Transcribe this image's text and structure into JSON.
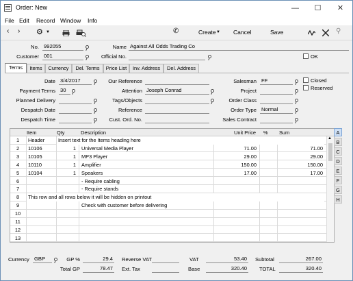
{
  "window": {
    "title": "Order: New"
  },
  "menu": [
    "File",
    "Edit",
    "Record",
    "Window",
    "Info"
  ],
  "toolbar": {
    "create": "Create",
    "cancel": "Cancel",
    "save": "Save"
  },
  "header": {
    "no_label": "No.",
    "no_value": "992055",
    "name_label": "Name",
    "name_value": "Against All Odds Trading Co",
    "customer_label": "Customer",
    "customer_value": "001",
    "official_label": "Official No.",
    "official_value": "",
    "ok_label": "OK"
  },
  "tabs": [
    "Terms",
    "Items",
    "Currency",
    "Del. Terms",
    "Price List",
    "Inv. Address",
    "Del. Address"
  ],
  "terms": {
    "date_label": "Date",
    "date_value": "3/4/2017",
    "payterms_label": "Payment Terms",
    "payterms_value": "30",
    "planned_label": "Planned Delivery",
    "planned_value": "",
    "despdate_label": "Despatch Date",
    "despdate_value": "",
    "desptime_label": "Despatch Time",
    "desptime_value": "",
    "ourref_label": "Our Reference",
    "ourref_value": "",
    "attention_label": "Attention",
    "attention_value": "Joseph Conrad",
    "tags_label": "Tags/Objects",
    "tags_value": "",
    "reference_label": "Reference",
    "reference_value": "",
    "custord_label": "Cust. Ord. No.",
    "custord_value": "",
    "salesman_label": "Salesman",
    "salesman_value": "FF",
    "project_label": "Project",
    "project_value": "",
    "orderclass_label": "Order Class",
    "orderclass_value": "",
    "ordertype_label": "Order Type",
    "ordertype_value": "Normal",
    "salescontract_label": "Sales Contract",
    "salescontract_value": "",
    "closed_label": "Closed",
    "reserved_label": "Reserved"
  },
  "grid": {
    "headers": {
      "item": "Item",
      "qty": "Qty",
      "desc": "Description",
      "price": "Unit Price",
      "pct": "%",
      "sum": "Sum"
    },
    "rows": [
      {
        "n": "1",
        "item": "Header",
        "qty": "",
        "desc": "",
        "price": "",
        "pct": "",
        "sum": "",
        "note": "Insert text for the Items heading here"
      },
      {
        "n": "2",
        "item": "10106",
        "qty": "1",
        "desc": "Universal Media Player",
        "price": "71.00",
        "pct": "",
        "sum": "71.00",
        "note": ""
      },
      {
        "n": "3",
        "item": "10105",
        "qty": "1",
        "desc": "MP3 Player",
        "price": "29.00",
        "pct": "",
        "sum": "29.00",
        "note": ""
      },
      {
        "n": "4",
        "item": "10110",
        "qty": "1",
        "desc": "Amplifier",
        "price": "150.00",
        "pct": "",
        "sum": "150.00",
        "note": ""
      },
      {
        "n": "5",
        "item": "10104",
        "qty": "1",
        "desc": "Speakers",
        "price": "17.00",
        "pct": "",
        "sum": "17.00",
        "note": ""
      },
      {
        "n": "6",
        "item": "",
        "qty": "",
        "desc": "- Require cabling",
        "price": "",
        "pct": "",
        "sum": "",
        "note": ""
      },
      {
        "n": "7",
        "item": "",
        "qty": "",
        "desc": "- Require stands",
        "price": "",
        "pct": "",
        "sum": "",
        "note": ""
      },
      {
        "n": "8",
        "item": "",
        "qty": "",
        "desc": "",
        "price": "",
        "pct": "",
        "sum": "",
        "note": "This row and all rows below it will be hidden on printout"
      },
      {
        "n": "9",
        "item": "",
        "qty": "",
        "desc": "Check with customer before delivering",
        "price": "",
        "pct": "",
        "sum": "",
        "note": ""
      },
      {
        "n": "10",
        "item": "",
        "qty": "",
        "desc": "",
        "price": "",
        "pct": "",
        "sum": "",
        "note": ""
      },
      {
        "n": "11",
        "item": "",
        "qty": "",
        "desc": "",
        "price": "",
        "pct": "",
        "sum": "",
        "note": ""
      },
      {
        "n": "12",
        "item": "",
        "qty": "",
        "desc": "",
        "price": "",
        "pct": "",
        "sum": "",
        "note": ""
      },
      {
        "n": "13",
        "item": "",
        "qty": "",
        "desc": "",
        "price": "",
        "pct": "",
        "sum": "",
        "note": ""
      }
    ],
    "letters": [
      "A",
      "B",
      "C",
      "D",
      "E",
      "F",
      "G",
      "H"
    ]
  },
  "footer": {
    "currency_label": "Currency",
    "currency_value": "GBP",
    "gp_label": "GP %",
    "gp_value": "29.4",
    "totalgp_label": "Total GP",
    "totalgp_value": "78.47",
    "revvat_label": "Reverse VAT",
    "revvat_value": "",
    "exttax_label": "Ext. Tax",
    "exttax_value": "",
    "vat_label": "VAT",
    "vat_value": "53.40",
    "base_label": "Base",
    "base_value": "320.40",
    "subtotal_label": "Subtotal",
    "subtotal_value": "267.00",
    "total_label": "TOTAL",
    "total_value": "320.40"
  }
}
